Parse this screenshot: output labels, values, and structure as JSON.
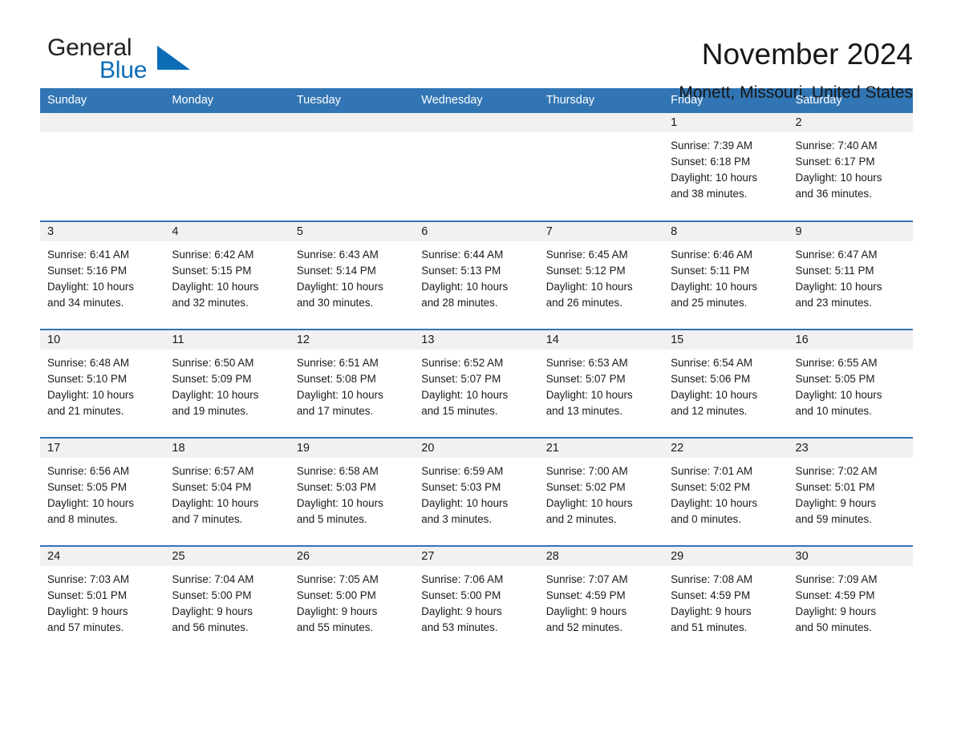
{
  "brand": {
    "name_part1": "General",
    "name_part2": "Blue",
    "flag_icon": "blue-triangle-flag-icon",
    "accent_color": "#0c6cb5"
  },
  "header": {
    "title": "November 2024",
    "subtitle": "Monett, Missouri, United States",
    "header_bg_color": "#3175b4",
    "daynum_bg_color": "#f1f1f1"
  },
  "weekday_headers": [
    "Sunday",
    "Monday",
    "Tuesday",
    "Wednesday",
    "Thursday",
    "Friday",
    "Saturday"
  ],
  "weeks": [
    [
      {
        "day": "",
        "sunrise": "",
        "sunset": "",
        "daylight_line1": "",
        "daylight_line2": ""
      },
      {
        "day": "",
        "sunrise": "",
        "sunset": "",
        "daylight_line1": "",
        "daylight_line2": ""
      },
      {
        "day": "",
        "sunrise": "",
        "sunset": "",
        "daylight_line1": "",
        "daylight_line2": ""
      },
      {
        "day": "",
        "sunrise": "",
        "sunset": "",
        "daylight_line1": "",
        "daylight_line2": ""
      },
      {
        "day": "",
        "sunrise": "",
        "sunset": "",
        "daylight_line1": "",
        "daylight_line2": ""
      },
      {
        "day": "1",
        "sunrise": "Sunrise: 7:39 AM",
        "sunset": "Sunset: 6:18 PM",
        "daylight_line1": "Daylight: 10 hours",
        "daylight_line2": "and 38 minutes."
      },
      {
        "day": "2",
        "sunrise": "Sunrise: 7:40 AM",
        "sunset": "Sunset: 6:17 PM",
        "daylight_line1": "Daylight: 10 hours",
        "daylight_line2": "and 36 minutes."
      }
    ],
    [
      {
        "day": "3",
        "sunrise": "Sunrise: 6:41 AM",
        "sunset": "Sunset: 5:16 PM",
        "daylight_line1": "Daylight: 10 hours",
        "daylight_line2": "and 34 minutes."
      },
      {
        "day": "4",
        "sunrise": "Sunrise: 6:42 AM",
        "sunset": "Sunset: 5:15 PM",
        "daylight_line1": "Daylight: 10 hours",
        "daylight_line2": "and 32 minutes."
      },
      {
        "day": "5",
        "sunrise": "Sunrise: 6:43 AM",
        "sunset": "Sunset: 5:14 PM",
        "daylight_line1": "Daylight: 10 hours",
        "daylight_line2": "and 30 minutes."
      },
      {
        "day": "6",
        "sunrise": "Sunrise: 6:44 AM",
        "sunset": "Sunset: 5:13 PM",
        "daylight_line1": "Daylight: 10 hours",
        "daylight_line2": "and 28 minutes."
      },
      {
        "day": "7",
        "sunrise": "Sunrise: 6:45 AM",
        "sunset": "Sunset: 5:12 PM",
        "daylight_line1": "Daylight: 10 hours",
        "daylight_line2": "and 26 minutes."
      },
      {
        "day": "8",
        "sunrise": "Sunrise: 6:46 AM",
        "sunset": "Sunset: 5:11 PM",
        "daylight_line1": "Daylight: 10 hours",
        "daylight_line2": "and 25 minutes."
      },
      {
        "day": "9",
        "sunrise": "Sunrise: 6:47 AM",
        "sunset": "Sunset: 5:11 PM",
        "daylight_line1": "Daylight: 10 hours",
        "daylight_line2": "and 23 minutes."
      }
    ],
    [
      {
        "day": "10",
        "sunrise": "Sunrise: 6:48 AM",
        "sunset": "Sunset: 5:10 PM",
        "daylight_line1": "Daylight: 10 hours",
        "daylight_line2": "and 21 minutes."
      },
      {
        "day": "11",
        "sunrise": "Sunrise: 6:50 AM",
        "sunset": "Sunset: 5:09 PM",
        "daylight_line1": "Daylight: 10 hours",
        "daylight_line2": "and 19 minutes."
      },
      {
        "day": "12",
        "sunrise": "Sunrise: 6:51 AM",
        "sunset": "Sunset: 5:08 PM",
        "daylight_line1": "Daylight: 10 hours",
        "daylight_line2": "and 17 minutes."
      },
      {
        "day": "13",
        "sunrise": "Sunrise: 6:52 AM",
        "sunset": "Sunset: 5:07 PM",
        "daylight_line1": "Daylight: 10 hours",
        "daylight_line2": "and 15 minutes."
      },
      {
        "day": "14",
        "sunrise": "Sunrise: 6:53 AM",
        "sunset": "Sunset: 5:07 PM",
        "daylight_line1": "Daylight: 10 hours",
        "daylight_line2": "and 13 minutes."
      },
      {
        "day": "15",
        "sunrise": "Sunrise: 6:54 AM",
        "sunset": "Sunset: 5:06 PM",
        "daylight_line1": "Daylight: 10 hours",
        "daylight_line2": "and 12 minutes."
      },
      {
        "day": "16",
        "sunrise": "Sunrise: 6:55 AM",
        "sunset": "Sunset: 5:05 PM",
        "daylight_line1": "Daylight: 10 hours",
        "daylight_line2": "and 10 minutes."
      }
    ],
    [
      {
        "day": "17",
        "sunrise": "Sunrise: 6:56 AM",
        "sunset": "Sunset: 5:05 PM",
        "daylight_line1": "Daylight: 10 hours",
        "daylight_line2": "and 8 minutes."
      },
      {
        "day": "18",
        "sunrise": "Sunrise: 6:57 AM",
        "sunset": "Sunset: 5:04 PM",
        "daylight_line1": "Daylight: 10 hours",
        "daylight_line2": "and 7 minutes."
      },
      {
        "day": "19",
        "sunrise": "Sunrise: 6:58 AM",
        "sunset": "Sunset: 5:03 PM",
        "daylight_line1": "Daylight: 10 hours",
        "daylight_line2": "and 5 minutes."
      },
      {
        "day": "20",
        "sunrise": "Sunrise: 6:59 AM",
        "sunset": "Sunset: 5:03 PM",
        "daylight_line1": "Daylight: 10 hours",
        "daylight_line2": "and 3 minutes."
      },
      {
        "day": "21",
        "sunrise": "Sunrise: 7:00 AM",
        "sunset": "Sunset: 5:02 PM",
        "daylight_line1": "Daylight: 10 hours",
        "daylight_line2": "and 2 minutes."
      },
      {
        "day": "22",
        "sunrise": "Sunrise: 7:01 AM",
        "sunset": "Sunset: 5:02 PM",
        "daylight_line1": "Daylight: 10 hours",
        "daylight_line2": "and 0 minutes."
      },
      {
        "day": "23",
        "sunrise": "Sunrise: 7:02 AM",
        "sunset": "Sunset: 5:01 PM",
        "daylight_line1": "Daylight: 9 hours",
        "daylight_line2": "and 59 minutes."
      }
    ],
    [
      {
        "day": "24",
        "sunrise": "Sunrise: 7:03 AM",
        "sunset": "Sunset: 5:01 PM",
        "daylight_line1": "Daylight: 9 hours",
        "daylight_line2": "and 57 minutes."
      },
      {
        "day": "25",
        "sunrise": "Sunrise: 7:04 AM",
        "sunset": "Sunset: 5:00 PM",
        "daylight_line1": "Daylight: 9 hours",
        "daylight_line2": "and 56 minutes."
      },
      {
        "day": "26",
        "sunrise": "Sunrise: 7:05 AM",
        "sunset": "Sunset: 5:00 PM",
        "daylight_line1": "Daylight: 9 hours",
        "daylight_line2": "and 55 minutes."
      },
      {
        "day": "27",
        "sunrise": "Sunrise: 7:06 AM",
        "sunset": "Sunset: 5:00 PM",
        "daylight_line1": "Daylight: 9 hours",
        "daylight_line2": "and 53 minutes."
      },
      {
        "day": "28",
        "sunrise": "Sunrise: 7:07 AM",
        "sunset": "Sunset: 4:59 PM",
        "daylight_line1": "Daylight: 9 hours",
        "daylight_line2": "and 52 minutes."
      },
      {
        "day": "29",
        "sunrise": "Sunrise: 7:08 AM",
        "sunset": "Sunset: 4:59 PM",
        "daylight_line1": "Daylight: 9 hours",
        "daylight_line2": "and 51 minutes."
      },
      {
        "day": "30",
        "sunrise": "Sunrise: 7:09 AM",
        "sunset": "Sunset: 4:59 PM",
        "daylight_line1": "Daylight: 9 hours",
        "daylight_line2": "and 50 minutes."
      }
    ]
  ]
}
